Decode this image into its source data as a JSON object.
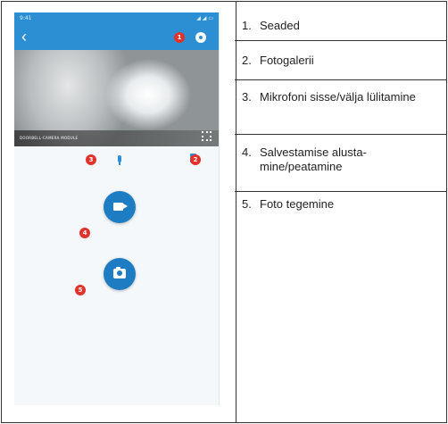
{
  "phone": {
    "status_time": "9:41",
    "status_icons": "◢ ◢ ▭",
    "back_glyph": "‹",
    "camera_label": "DOORBELL-CAMERA MODULE",
    "markers": [
      "1",
      "2",
      "3",
      "4",
      "5"
    ]
  },
  "legend": {
    "items": [
      {
        "num": "1.",
        "text": "Seaded"
      },
      {
        "num": "2.",
        "text": "Fotogalerii"
      },
      {
        "num": "3.",
        "text": "Mikrofoni sisse/välja lülitamine"
      },
      {
        "num": "4.",
        "text": "Salvestamise alusta-mine/peatamine"
      },
      {
        "num": "5.",
        "text": "Foto tegemine"
      }
    ]
  },
  "colors": {
    "app_blue": "#2d8fd3",
    "button_blue": "#1e7cc2",
    "marker_red": "#e1322b"
  },
  "icons": [
    "back-icon",
    "settings-gear-icon",
    "fullscreen-icon",
    "microphone-icon",
    "gallery-icon",
    "video-record-icon",
    "photo-camera-icon"
  ]
}
